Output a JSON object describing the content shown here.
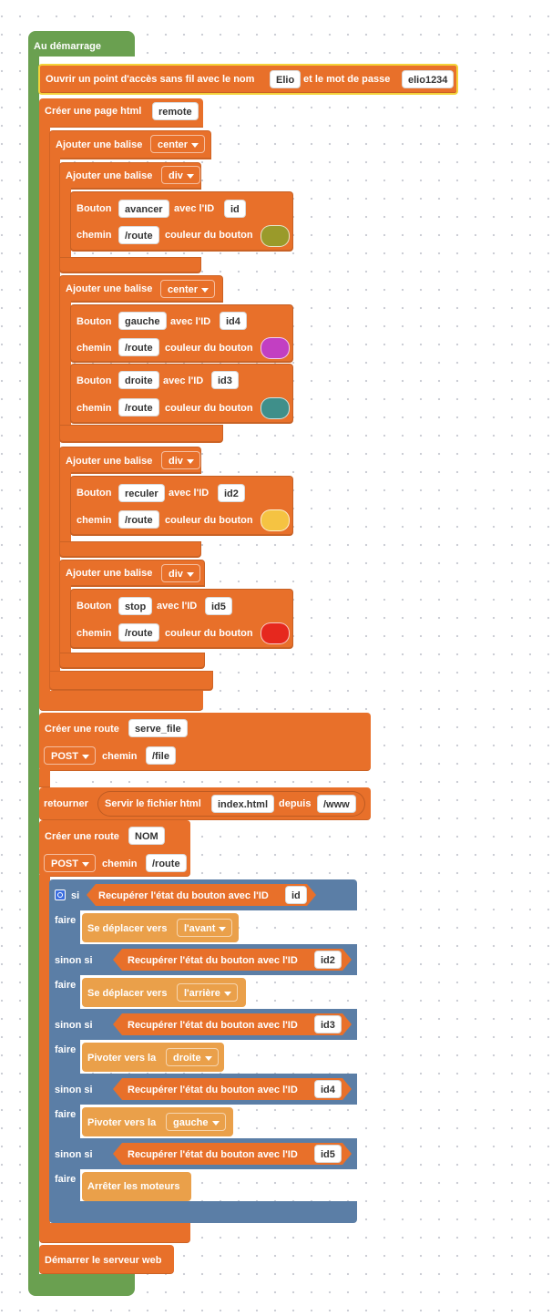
{
  "start_block": {
    "label": "Au démarrage"
  },
  "wifi": {
    "label_before": "Ouvrir un point d'accès sans fil avec le nom",
    "name": "Elio",
    "label_mid": "et le mot de passe",
    "password": "elio1234"
  },
  "page": {
    "label": "Créer une page html",
    "name": "remote"
  },
  "tag_label": "Ajouter une balise",
  "btn_words": {
    "bouton": "Bouton",
    "avec_id": "avec l'ID",
    "chemin": "chemin",
    "couleur": "couleur du bouton"
  },
  "tags": {
    "center": "center",
    "div1": "div",
    "center2": "center",
    "div2": "div",
    "div3": "div"
  },
  "buttons": [
    {
      "name": "avancer",
      "id": "id",
      "path": "/route",
      "color": "#9a9a2a"
    },
    {
      "name": "gauche",
      "id": "id4",
      "path": "/route",
      "color": "#c23fc2"
    },
    {
      "name": "droite",
      "id": "id3",
      "path": "/route",
      "color": "#3f8f8a"
    },
    {
      "name": "reculer",
      "id": "id2",
      "path": "/route",
      "color": "#f5c342"
    },
    {
      "name": "stop",
      "id": "id5",
      "path": "/route",
      "color": "#e6281e"
    }
  ],
  "route1": {
    "label": "Créer une route",
    "name": "serve_file",
    "method": "POST",
    "chemin_label": "chemin",
    "path": "/file"
  },
  "return_stmt": {
    "label": "retourner",
    "serve_label": "Servir le fichier html",
    "file": "index.html",
    "depuis": "depuis",
    "dir": "/www"
  },
  "route2": {
    "label": "Créer une route",
    "name": "NOM",
    "method": "POST",
    "chemin_label": "chemin",
    "path": "/route"
  },
  "if_block": {
    "si": "si",
    "faire": "faire",
    "sinon_si": "sinon si",
    "cond_label": "Recupérer l'état du bouton avec l'ID",
    "branches": [
      {
        "id": "id",
        "action": "Se déplacer vers",
        "arg": "l'avant"
      },
      {
        "id": "id2",
        "action": "Se déplacer vers",
        "arg": "l'arrière"
      },
      {
        "id": "id3",
        "action": "Pivoter vers  la",
        "arg": "droite"
      },
      {
        "id": "id4",
        "action": "Pivoter vers  la",
        "arg": "gauche"
      },
      {
        "id": "id5",
        "action": "Arrêter les moteurs",
        "arg": ""
      }
    ]
  },
  "server": {
    "label": "Démarrer le serveur web"
  }
}
